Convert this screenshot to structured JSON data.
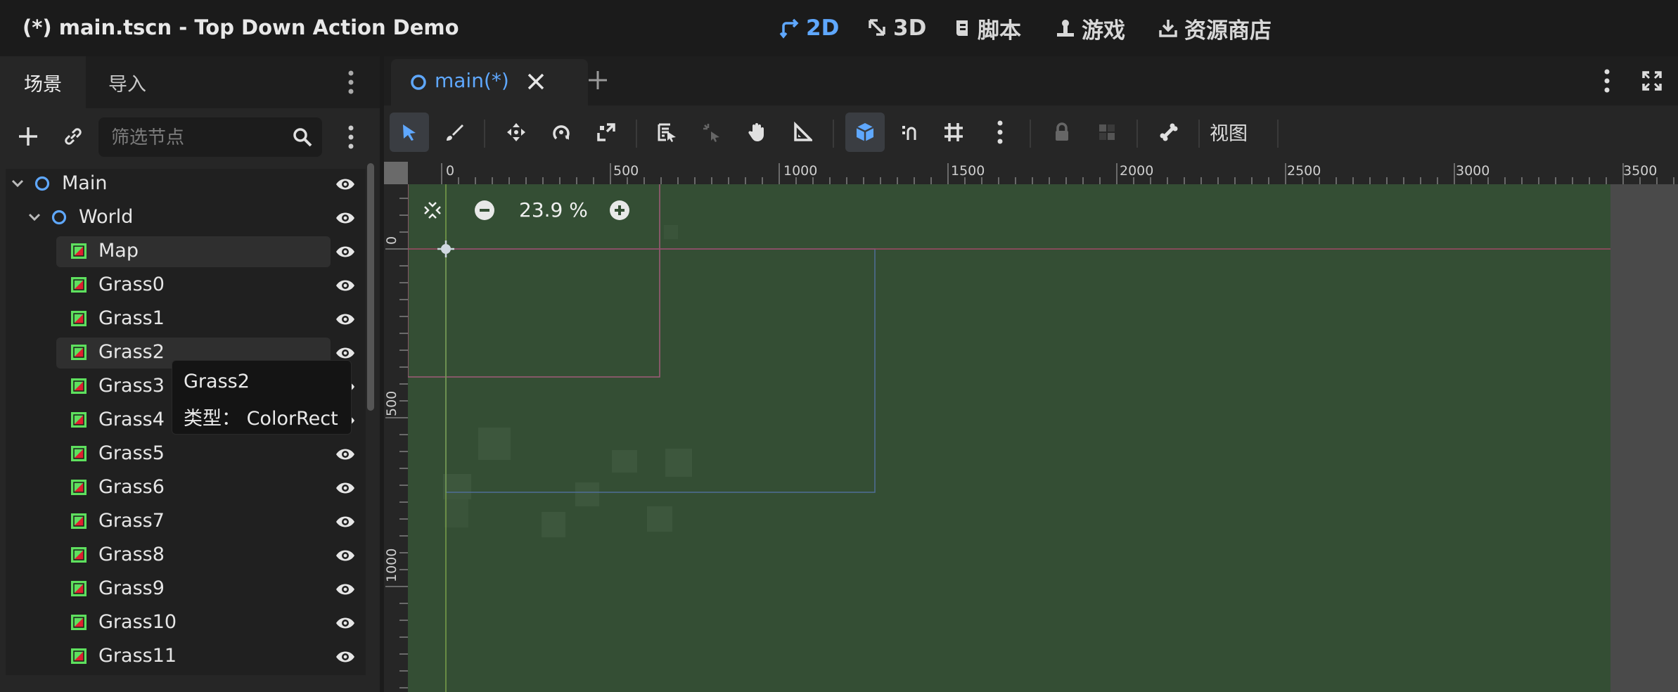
{
  "window": {
    "title": "(*) main.tscn - Top Down Action Demo"
  },
  "workspaces": [
    {
      "label": "2D",
      "icon": "2d-icon",
      "active": true
    },
    {
      "label": "3D",
      "icon": "3d-icon",
      "active": false
    },
    {
      "label": "脚本",
      "icon": "script-icon",
      "active": false
    },
    {
      "label": "游戏",
      "icon": "game-icon",
      "active": false
    },
    {
      "label": "资源商店",
      "icon": "assetlib-icon",
      "active": false
    }
  ],
  "dock": {
    "tabs": [
      {
        "label": "场景",
        "active": true
      },
      {
        "label": "导入",
        "active": false
      }
    ],
    "filter_placeholder": "筛选节点",
    "tree": [
      {
        "label": "Main",
        "type": "node2d",
        "depth": 0,
        "expanded": true
      },
      {
        "label": "World",
        "type": "node2d",
        "depth": 1,
        "expanded": true
      },
      {
        "label": "Map",
        "type": "colorrect",
        "depth": 2,
        "highlighted": true
      },
      {
        "label": "Grass0",
        "type": "colorrect",
        "depth": 2
      },
      {
        "label": "Grass1",
        "type": "colorrect",
        "depth": 2
      },
      {
        "label": "Grass2",
        "type": "colorrect",
        "depth": 2,
        "highlighted": true
      },
      {
        "label": "Grass3",
        "type": "colorrect",
        "depth": 2
      },
      {
        "label": "Grass4",
        "type": "colorrect",
        "depth": 2
      },
      {
        "label": "Grass5",
        "type": "colorrect",
        "depth": 2
      },
      {
        "label": "Grass6",
        "type": "colorrect",
        "depth": 2
      },
      {
        "label": "Grass7",
        "type": "colorrect",
        "depth": 2
      },
      {
        "label": "Grass8",
        "type": "colorrect",
        "depth": 2
      },
      {
        "label": "Grass9",
        "type": "colorrect",
        "depth": 2
      },
      {
        "label": "Grass10",
        "type": "colorrect",
        "depth": 2
      },
      {
        "label": "Grass11",
        "type": "colorrect",
        "depth": 2
      }
    ]
  },
  "tooltip": {
    "name": "Grass2",
    "type_line": "类型： ColorRect"
  },
  "editor": {
    "scene_tab": "main(*)",
    "view_menu": "视图",
    "zoom": "23.9 %",
    "ruler_h": [
      "0",
      "500",
      "1000",
      "1500",
      "2000",
      "2500",
      "3000",
      "3500"
    ],
    "ruler_v": [
      "0",
      "500",
      "1000"
    ]
  },
  "colors": {
    "accent": "#5fa8ff",
    "viewport": "#344e34",
    "grass_icon": "#5ee05e"
  }
}
